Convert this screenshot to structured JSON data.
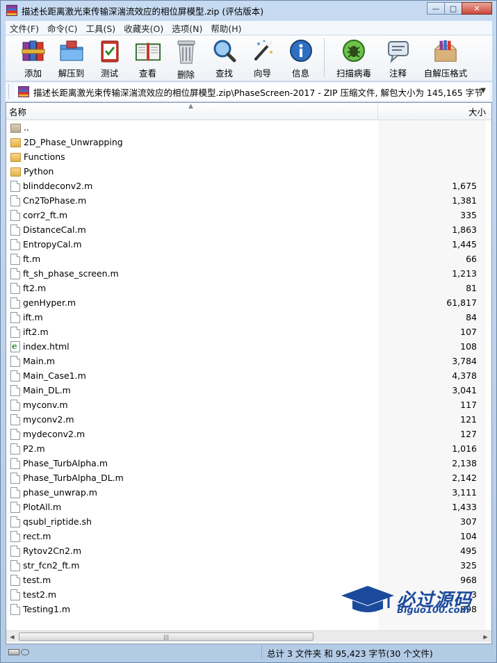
{
  "window": {
    "title": "描述长距离激光束传输深湍流效应的相位屏模型.zip (评估版本)",
    "controls": {
      "minimize": "—",
      "maximize": "□",
      "close": "✕"
    }
  },
  "menu": [
    "文件(F)",
    "命令(C)",
    "工具(S)",
    "收藏夹(O)",
    "选项(N)",
    "帮助(H)"
  ],
  "toolbar": [
    {
      "label": "添加",
      "icon": "add-books-icon"
    },
    {
      "label": "解压到",
      "icon": "extract-folder-icon"
    },
    {
      "label": "测试",
      "icon": "test-clipboard-icon"
    },
    {
      "label": "查看",
      "icon": "view-book-icon"
    },
    {
      "label": "删除",
      "icon": "trash-icon"
    },
    {
      "label": "查找",
      "icon": "find-magnifier-icon"
    },
    {
      "label": "向导",
      "icon": "wizard-wand-icon"
    },
    {
      "label": "信息",
      "icon": "info-icon"
    },
    {
      "label": "扫描病毒",
      "icon": "virus-scan-icon"
    },
    {
      "label": "注释",
      "icon": "comment-icon"
    },
    {
      "label": "自解压格式",
      "icon": "sfx-box-icon"
    }
  ],
  "address": {
    "path": "描述长距离激光束传输深湍流效应的相位屏模型.zip\\PhaseScreen-2017 - ZIP 压缩文件, 解包大小为 145,165 字节"
  },
  "columns": {
    "name": "名称",
    "size": "大小"
  },
  "files": [
    {
      "name": "..",
      "size": "",
      "type": "up"
    },
    {
      "name": "2D_Phase_Unwrapping",
      "size": "",
      "type": "folder"
    },
    {
      "name": "Functions",
      "size": "",
      "type": "folder"
    },
    {
      "name": "Python",
      "size": "",
      "type": "folder"
    },
    {
      "name": "blinddeconv2.m",
      "size": "1,675",
      "type": "file"
    },
    {
      "name": "Cn2ToPhase.m",
      "size": "1,381",
      "type": "file"
    },
    {
      "name": "corr2_ft.m",
      "size": "335",
      "type": "file"
    },
    {
      "name": "DistanceCal.m",
      "size": "1,863",
      "type": "file"
    },
    {
      "name": "EntropyCal.m",
      "size": "1,445",
      "type": "file"
    },
    {
      "name": "ft.m",
      "size": "66",
      "type": "file"
    },
    {
      "name": "ft_sh_phase_screen.m",
      "size": "1,213",
      "type": "file"
    },
    {
      "name": "ft2.m",
      "size": "81",
      "type": "file"
    },
    {
      "name": "genHyper.m",
      "size": "61,817",
      "type": "file"
    },
    {
      "name": "ift.m",
      "size": "84",
      "type": "file"
    },
    {
      "name": "ift2.m",
      "size": "107",
      "type": "file"
    },
    {
      "name": "index.html",
      "size": "108",
      "type": "html"
    },
    {
      "name": "Main.m",
      "size": "3,784",
      "type": "file"
    },
    {
      "name": "Main_Case1.m",
      "size": "4,378",
      "type": "file"
    },
    {
      "name": "Main_DL.m",
      "size": "3,041",
      "type": "file"
    },
    {
      "name": "myconv.m",
      "size": "117",
      "type": "file"
    },
    {
      "name": "myconv2.m",
      "size": "121",
      "type": "file"
    },
    {
      "name": "mydeconv2.m",
      "size": "127",
      "type": "file"
    },
    {
      "name": "P2.m",
      "size": "1,016",
      "type": "file"
    },
    {
      "name": "Phase_TurbAlpha.m",
      "size": "2,138",
      "type": "file"
    },
    {
      "name": "Phase_TurbAlpha_DL.m",
      "size": "2,142",
      "type": "file"
    },
    {
      "name": "phase_unwrap.m",
      "size": "3,111",
      "type": "file"
    },
    {
      "name": "PlotAll.m",
      "size": "1,433",
      "type": "file"
    },
    {
      "name": "qsubl_riptide.sh",
      "size": "307",
      "type": "file"
    },
    {
      "name": "rect.m",
      "size": "104",
      "type": "file"
    },
    {
      "name": "Rytov2Cn2.m",
      "size": "495",
      "type": "file"
    },
    {
      "name": "str_fcn2_ft.m",
      "size": "325",
      "type": "file"
    },
    {
      "name": "test.m",
      "size": "968",
      "type": "file"
    },
    {
      "name": "test2.m",
      "size": "3",
      "type": "file"
    },
    {
      "name": "Testing1.m",
      "size": "998",
      "type": "file"
    }
  ],
  "status": {
    "summary": "总计 3 文件夹 和 95,423 字节(30 个文件)"
  },
  "watermark": {
    "title": "必过源码",
    "subtitle": "Biguo100.com"
  },
  "colors": {
    "chrome": "#bcd3ec",
    "list_bg": "#ffffff",
    "watermark": "#1b4a9c"
  }
}
